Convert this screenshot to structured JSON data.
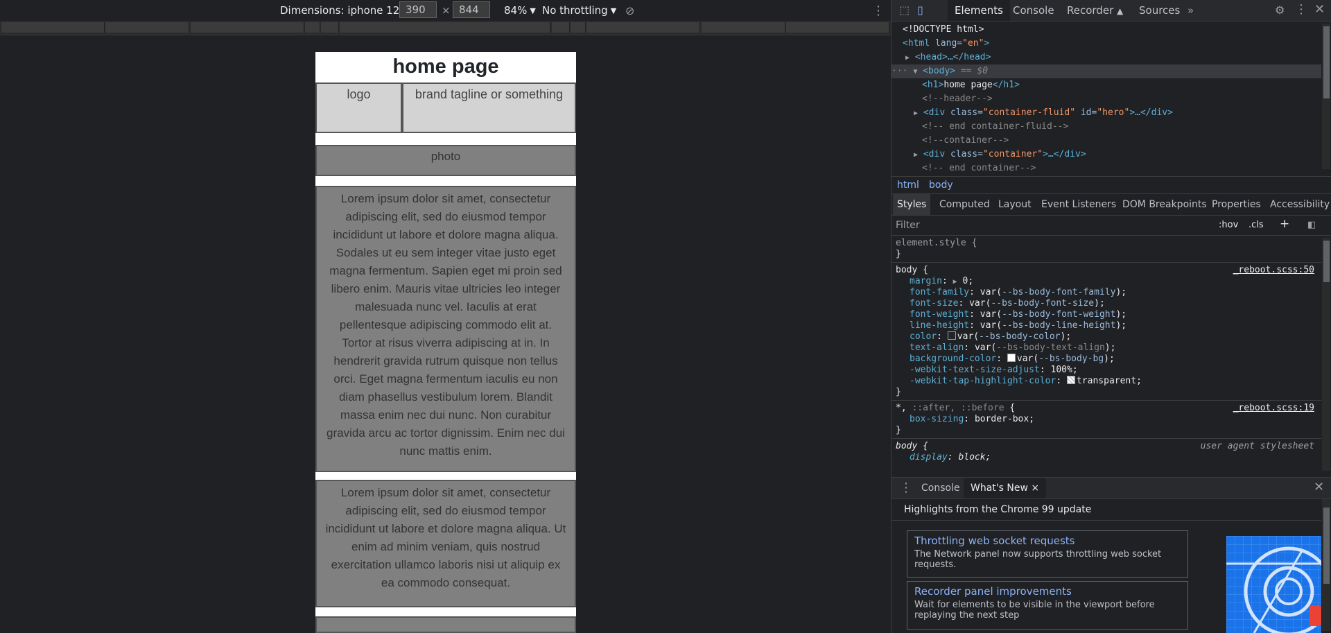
{
  "device_toolbar": {
    "dimensions_label": "Dimensions: iphone 12",
    "width": "390",
    "times": "×",
    "height": "844",
    "zoom": "84%",
    "throttling": "No throttling"
  },
  "viewport": {
    "heading": "home page",
    "logo": "logo",
    "tagline": "brand tagline or something",
    "photo": "photo",
    "lorem_long": "Lorem ipsum dolor sit amet, consectetur adipiscing elit, sed do eiusmod tempor incididunt ut labore et dolore magna aliqua. Sodales ut eu sem integer vitae justo eget magna fermentum. Sapien eget mi proin sed libero enim. Mauris vitae ultricies leo integer malesuada nunc vel. Iaculis at erat pellentesque adipiscing commodo elit at. Tortor at risus viverra adipiscing at in. In hendrerit gravida rutrum quisque non tellus orci. Eget magna fermentum iaculis eu non diam phasellus vestibulum lorem. Blandit massa enim nec dui nunc. Non curabitur gravida arcu ac tortor dignissim. Enim nec dui nunc mattis enim.",
    "lorem_short": "Lorem ipsum dolor sit amet, consectetur adipiscing elit, sed do eiusmod tempor incididunt ut labore et dolore magna aliqua. Ut enim ad minim veniam, quis nostrud exercitation ullamco laboris nisi ut aliquip ex ea commodo consequat."
  },
  "devtools": {
    "tabs": [
      "Elements",
      "Console",
      "Recorder",
      "Sources",
      "»"
    ],
    "dom": {
      "doctype": "<!DOCTYPE html>",
      "html_open_tag": "<html",
      "lang_attr": " lang=",
      "lang_val": "\"en\"",
      "close_gt": ">",
      "head": "<head>…</head>",
      "body_tag": "<body>",
      "body_eq": " == $0",
      "dots": "···",
      "h1_open": "<h1>",
      "h1_text": "home page",
      "h1_close": "</h1>",
      "comment_header": "<!--header-->",
      "div_open": "<div",
      "class_attr": " class=",
      "hero_class_val": "\"container-fluid\"",
      "id_attr": " id=",
      "hero_id_val": "\"hero\"",
      "ellipsis_close": ">…</div>",
      "comment_end_fluid": "<!-- end container-fluid-->",
      "comment_container": "<!--container-->",
      "container_class_val": "\"container\"",
      "comment_end_container": "<!-- end container-->"
    },
    "breadcrumb": [
      "html",
      "body"
    ],
    "subtabs": [
      "Styles",
      "Computed",
      "Layout",
      "Event Listeners",
      "DOM Breakpoints",
      "Properties",
      "Accessibility"
    ],
    "filter": {
      "placeholder": "Filter",
      "hov": ":hov",
      "cls": ".cls",
      "plus": "+"
    },
    "styles": {
      "element_style": "element.style {",
      "close": "}",
      "body_selector": "body {",
      "body_source": "_reboot.scss:50",
      "props": {
        "margin": "margin",
        "margin_val": "0",
        "font_family": "font-family",
        "font_family_var": "--bs-body-font-family",
        "font_size": "font-size",
        "font_size_var": "--bs-body-font-size",
        "font_weight": "font-weight",
        "font_weight_var": "--bs-body-font-weight",
        "line_height": "line-height",
        "line_height_var": "--bs-body-line-height",
        "color": "color",
        "color_var": "--bs-body-color",
        "text_align": "text-align",
        "text_align_var": "--bs-body-text-align",
        "background_color": "background-color",
        "background_color_var": "--bs-body-bg",
        "text_size_adjust": "-webkit-text-size-adjust",
        "text_size_adjust_val": "100%",
        "tap_highlight": "-webkit-tap-highlight-color",
        "tap_highlight_val": "transparent",
        "box_sizing": "box-sizing",
        "box_sizing_val": "border-box",
        "display": "display",
        "display_val": "block"
      },
      "var_open": "var(",
      "var_close": ");",
      "colon": ": ",
      "semi": ";",
      "universal_star": "*, ",
      "universal_pseudo": "::after, ::before",
      "universal_brace": " {",
      "universal_source": "_reboot.scss:19",
      "ua_body_selector": "body {",
      "ua_label": "user agent stylesheet"
    },
    "drawer": {
      "tabs": [
        "Console",
        "What's New"
      ],
      "close_x": "×",
      "highlights": "Highlights from the Chrome 99 update",
      "cards": [
        {
          "title": "Throttling web socket requests",
          "body": "The Network panel now supports throttling web socket requests."
        },
        {
          "title": "Recorder panel improvements",
          "body": "Wait for elements to be visible in the viewport before replaying the next step"
        }
      ]
    },
    "icons": [
      "inspect-icon",
      "device-toggle-icon",
      "settings-gear-icon",
      "kebab-menu-icon",
      "close-icon",
      "rotate-icon",
      "recorder-flask-icon"
    ]
  }
}
